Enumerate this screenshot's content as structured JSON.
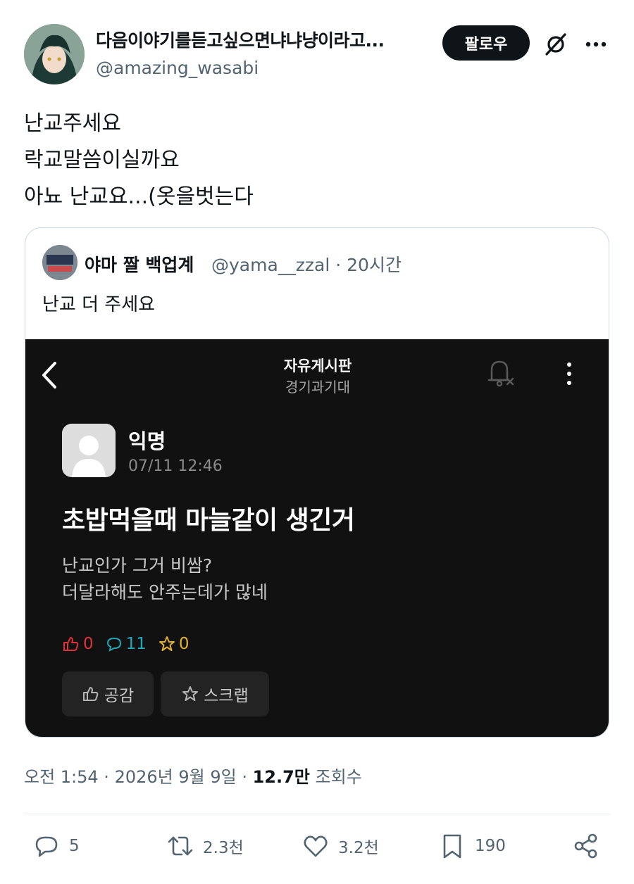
{
  "author": {
    "display_name": "다음이야기를듣고싶으면냐냐냥이라고...",
    "handle": "@amazing_wasabi",
    "follow_label": "팔로우"
  },
  "tweet": {
    "lines": [
      "난교주세요",
      "락교말씀이실까요",
      "아뇨 난교요...(옷을벗는다"
    ]
  },
  "quote": {
    "name": "야마 짤 백업계",
    "handle_time": "@yama__zzal · 20시간",
    "text": "난교 더 주세요",
    "embed": {
      "board": "자유게시판",
      "sub": "경기과기대",
      "author": "익명",
      "time": "07/11 12:46",
      "title": "초밥먹을때 마늘같이 생긴거",
      "body": [
        "난교인가 그거 비쌈?",
        "더달라해도 안주는데가 많네"
      ],
      "likes": "0",
      "comments": "11",
      "scraps": "0",
      "like_btn": "공감",
      "scrap_btn": "스크랩",
      "like_color": "#e0303a",
      "comment_color": "#1fa9b8",
      "scrap_color": "#e2b227"
    }
  },
  "meta": {
    "time_date": "오전 1:54 · 2026년 9월 9일 · ",
    "views": "12.7만",
    "views_label": " 조회수"
  },
  "actions": {
    "replies": "5",
    "reposts": "2.3천",
    "likes": "3.2천",
    "bookmarks": "190"
  }
}
